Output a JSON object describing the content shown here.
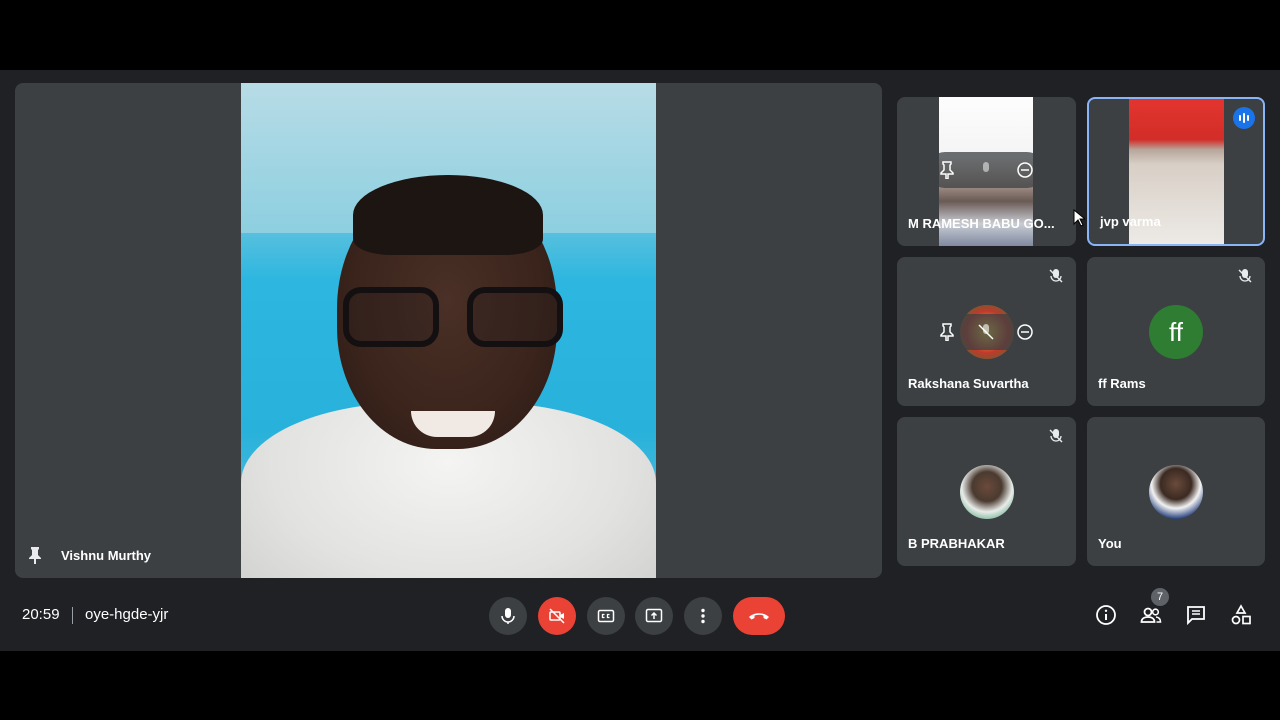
{
  "stage": {
    "presenter_name": "Vishnu Murthy"
  },
  "participants": [
    {
      "name": "M RAMESH BABU GO...",
      "muted": false,
      "kind": "video"
    },
    {
      "name": "jvp varma",
      "muted": false,
      "kind": "video",
      "speaking": true
    },
    {
      "name": "Rakshana Suvartha",
      "muted": true,
      "kind": "photo"
    },
    {
      "name": "ff Rams",
      "muted": true,
      "kind": "letter",
      "initials": "ff"
    },
    {
      "name": "B PRABHAKAR",
      "muted": true,
      "kind": "photo"
    },
    {
      "name": "You",
      "muted": false,
      "kind": "photo"
    }
  ],
  "bottom_bar": {
    "time": "20:59",
    "meeting_code": "oye-hgde-yjr",
    "people_count": "7"
  },
  "colors": {
    "accent": "#8ab4f8",
    "danger": "#ea4335",
    "surface": "#3c4043",
    "background": "#202124"
  }
}
